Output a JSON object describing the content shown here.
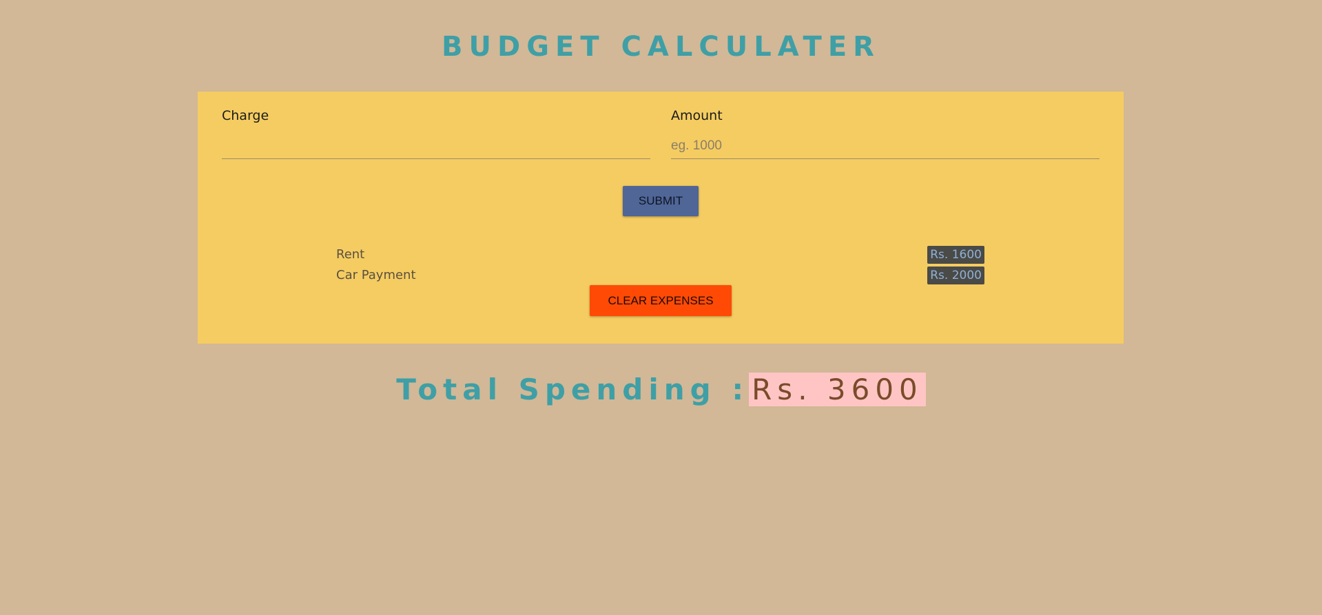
{
  "page": {
    "title": "BUDGET CALCULATER"
  },
  "form": {
    "charge_label": "Charge",
    "charge_value": "",
    "charge_placeholder": "",
    "amount_label": "Amount",
    "amount_value": "",
    "amount_placeholder": "eg. 1000",
    "submit_label": "SUBMIT"
  },
  "expenses": [
    {
      "charge": "Rent",
      "amount": "Rs. 1600"
    },
    {
      "charge": "Car Payment",
      "amount": "Rs. 2000"
    }
  ],
  "clear_label": "CLEAR EXPENSES",
  "total": {
    "label": "Total Spending :",
    "value": "Rs. 3600"
  },
  "colors": {
    "background": "#d2b896",
    "panel": "#f5cc61",
    "title": "#3f9fa6",
    "submit_button": "#4f6696",
    "clear_button": "#ff4a06",
    "amount_badge": "#4a4a47",
    "total_value_bg": "#ffc5c5"
  }
}
